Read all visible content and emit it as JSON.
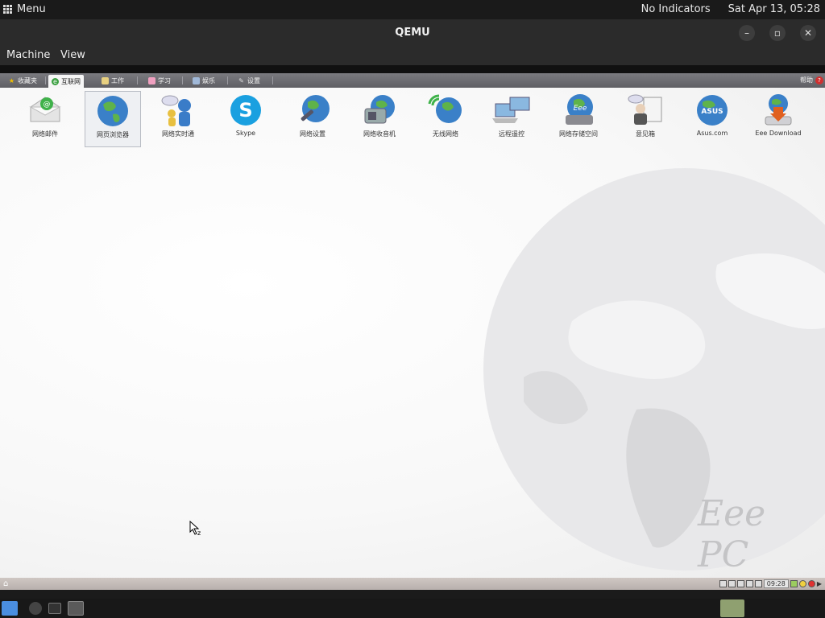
{
  "host": {
    "menu_label": "Menu",
    "indicators": "No Indicators",
    "datetime": "Sat Apr 13, 05:28"
  },
  "window": {
    "title": "QEMU",
    "menu": [
      "Machine",
      "View"
    ]
  },
  "guest": {
    "tabs": [
      {
        "label": "收藏夹",
        "icon": "star-icon"
      },
      {
        "label": "互联网",
        "icon": "internet-icon",
        "active": true
      },
      {
        "label": "工作",
        "icon": "work-icon"
      },
      {
        "label": "学习",
        "icon": "study-icon"
      },
      {
        "label": "娱乐",
        "icon": "play-icon"
      },
      {
        "label": "设置",
        "icon": "settings-icon"
      }
    ],
    "help_label": "帮助",
    "apps": [
      {
        "label": "网络邮件",
        "icon": "email-icon"
      },
      {
        "label": "网页浏览器",
        "icon": "globe-icon",
        "selected": true
      },
      {
        "label": "网络实时通",
        "icon": "messenger-icon"
      },
      {
        "label": "Skype",
        "icon": "skype-icon"
      },
      {
        "label": "网络设置",
        "icon": "network-settings-icon"
      },
      {
        "label": "网络收音机",
        "icon": "radio-icon"
      },
      {
        "label": "无线网络",
        "icon": "wireless-icon"
      },
      {
        "label": "远程遥控",
        "icon": "remote-icon"
      },
      {
        "label": "网络存储空间",
        "icon": "storage-icon"
      },
      {
        "label": "意见箱",
        "icon": "feedback-icon"
      },
      {
        "label": "Asus.com",
        "icon": "asus-icon"
      },
      {
        "label": "Eee Download",
        "icon": "download-icon"
      }
    ],
    "watermark": "Eee PC",
    "clock": "09:28"
  }
}
